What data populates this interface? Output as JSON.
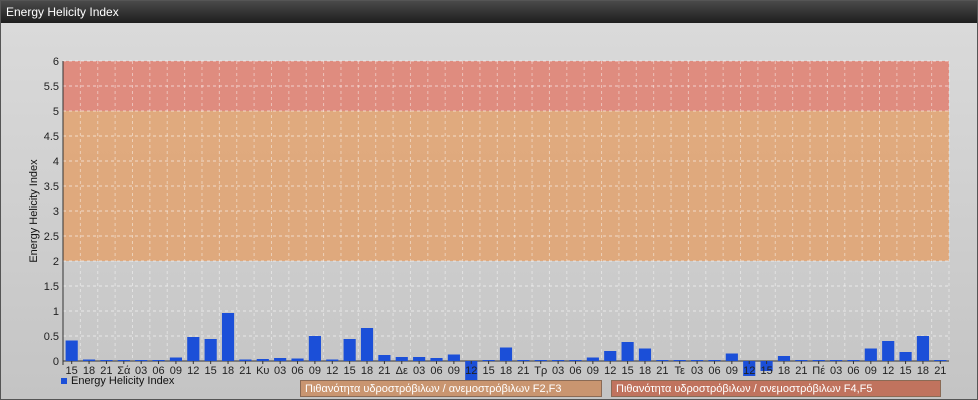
{
  "window": {
    "title": "Energy Helicity Index"
  },
  "legend": {
    "series_label": "Energy Helicity Index",
    "band_low": "Πιθανότητα υδροστρόβιλων / ανεμοστρόβιλων F2,F3",
    "band_high": "Πιθανότητα υδροστρόβιλων / ανεμοστρόβιλων F4,F5"
  },
  "colors": {
    "bar": "#1b4fd8",
    "band_low": "#e2a26e",
    "band_high": "#e07f70",
    "plot_background": "#c8c8c8"
  },
  "chart_data": {
    "type": "bar",
    "title": "",
    "xlabel": "",
    "ylabel": "Energy Helicity Index",
    "ylim": [
      0,
      6
    ],
    "yticks": [
      0,
      0.5,
      1,
      1.5,
      2,
      2.5,
      3,
      3.5,
      4,
      4.5,
      5,
      5.5,
      6
    ],
    "grid": true,
    "legend_position": "bottom-left",
    "bands": [
      {
        "from": 2,
        "to": 5,
        "label": "Πιθανότητα υδροστρόβιλων / ανεμοστρόβιλων F2,F3"
      },
      {
        "from": 5,
        "to": 6,
        "label": "Πιθανότητα υδροστρόβιλων / ανεμοστρόβιλων F4,F5"
      }
    ],
    "categories": [
      "15",
      "18",
      "21",
      "Σά",
      "03",
      "06",
      "09",
      "12",
      "15",
      "18",
      "21",
      "Κυ",
      "03",
      "06",
      "09",
      "12",
      "15",
      "18",
      "21",
      "Δε",
      "03",
      "06",
      "09",
      "12",
      "15",
      "18",
      "21",
      "Τρ",
      "03",
      "06",
      "09",
      "12",
      "15",
      "18",
      "21",
      "Τε",
      "03",
      "06",
      "09",
      "12",
      "15",
      "18",
      "21",
      "Πέ",
      "03",
      "06",
      "09",
      "12",
      "15",
      "18",
      "21"
    ],
    "series": [
      {
        "name": "Energy Helicity Index",
        "values": [
          0.41,
          0.03,
          0.02,
          0.02,
          0.02,
          0.02,
          0.07,
          0.48,
          0.44,
          0.96,
          0.03,
          0.04,
          0.06,
          0.05,
          0.5,
          0.03,
          0.44,
          0.66,
          0.12,
          0.08,
          0.08,
          0.06,
          0.13,
          -0.58,
          0.02,
          0.27,
          0.02,
          0.02,
          0.02,
          0.02,
          0.07,
          0.2,
          0.38,
          0.25,
          0.02,
          0.02,
          0.02,
          0.02,
          0.15,
          -0.3,
          -0.2,
          0.1,
          0.02,
          0.02,
          0.02,
          0.02,
          0.25,
          0.4,
          0.18,
          0.5,
          0.02
        ]
      }
    ]
  }
}
